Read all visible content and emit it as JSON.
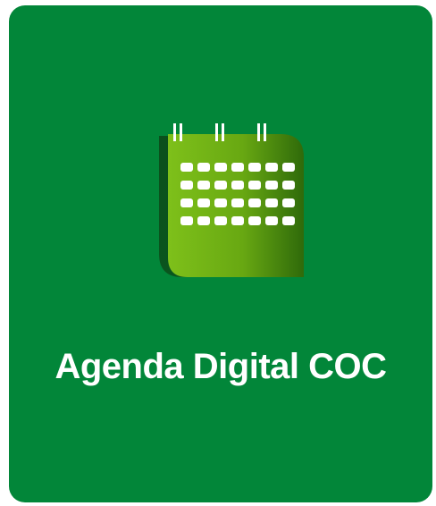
{
  "tile": {
    "label": "Agenda Digital COC",
    "background_color": "#028639",
    "icon": "calendar-icon"
  }
}
